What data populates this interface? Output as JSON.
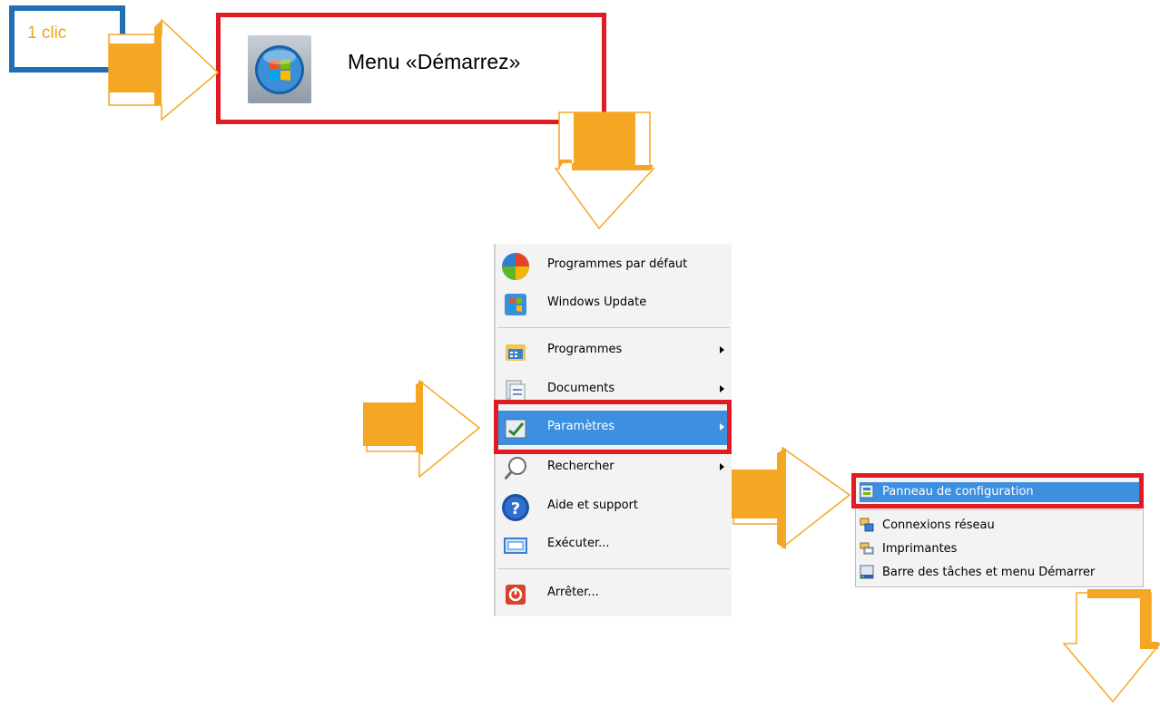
{
  "step_label": "1 clic",
  "start_menu": {
    "label": "Menu «Démarrez»",
    "icon": "windows-orb-icon"
  },
  "menu": {
    "items": [
      {
        "label": "Programmes par défaut",
        "icon": "default-programs-icon",
        "has_submenu": false
      },
      {
        "label": "Windows Update",
        "icon": "windows-update-icon",
        "has_submenu": false
      },
      {
        "label": "Programmes",
        "icon": "programs-folder-icon",
        "has_submenu": true
      },
      {
        "label": "Documents",
        "icon": "documents-icon",
        "has_submenu": true
      },
      {
        "label": "Paramètres",
        "icon": "settings-icon",
        "has_submenu": true,
        "highlighted": true
      },
      {
        "label": "Rechercher",
        "icon": "search-icon",
        "has_submenu": true
      },
      {
        "label": "Aide et support",
        "icon": "help-icon",
        "has_submenu": false
      },
      {
        "label": "Exécuter...",
        "icon": "run-icon",
        "has_submenu": false
      },
      {
        "label": "Arrêter...",
        "icon": "shutdown-icon",
        "has_submenu": false
      }
    ]
  },
  "submenu": {
    "items": [
      {
        "label": "Panneau de configuration",
        "icon": "control-panel-icon",
        "highlighted": true
      },
      {
        "label": "Connexions réseau",
        "icon": "network-connections-icon"
      },
      {
        "label": "Imprimantes",
        "icon": "printers-icon"
      },
      {
        "label": "Barre des tâches et menu Démarrer",
        "icon": "taskbar-icon"
      }
    ]
  },
  "colors": {
    "highlight_frame": "#e01b23",
    "arrow_fill": "#f5a623",
    "step_frame": "#1f6fb5",
    "menu_highlight": "#3d8fdf"
  }
}
